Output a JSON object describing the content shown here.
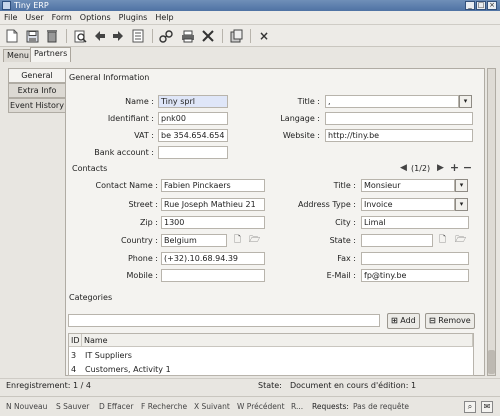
{
  "window": {
    "title": "Tiny ERP"
  },
  "menu": [
    "File",
    "User",
    "Form",
    "Options",
    "Plugins",
    "Help"
  ],
  "toolbar": {
    "icons": [
      "new-icon",
      "save-icon",
      "delete-icon",
      "find-icon",
      "previous-icon",
      "next-icon",
      "switch-view-icon",
      "attach-icon",
      "print-icon",
      "action-icon",
      "plugin-icon",
      "close-icon"
    ]
  },
  "tabs": [
    "Menu",
    "Partners"
  ],
  "vtabs": [
    "General",
    "Extra Info",
    "Event History"
  ],
  "general": {
    "heading": "General Information",
    "name_label": "Name :",
    "name_value": "Tiny sprl",
    "title_label": "Title :",
    "title_value": ",",
    "ident_label": "Identifiant :",
    "ident_value": "pnk00",
    "lang_label": "Langage :",
    "lang_value": "",
    "vat_label": "VAT :",
    "vat_value": "be 354.654.654",
    "website_label": "Website :",
    "website_value": "http://tiny.be",
    "bank_label": "Bank account :",
    "bank_value": ""
  },
  "contacts": {
    "heading": "Contacts",
    "pager": "(1/2)",
    "contact_label": "Contact Name :",
    "contact_value": "Fabien Pinckaers",
    "ctitle_label": "Title :",
    "ctitle_value": "Monsieur",
    "street_label": "Street :",
    "street_value": "Rue Joseph Mathieu 21",
    "addrtype_label": "Address Type :",
    "addrtype_value": "Invoice",
    "zip_label": "Zip :",
    "zip_value": "1300",
    "city_label": "City :",
    "city_value": "Limal",
    "country_label": "Country :",
    "country_value": "Belgium",
    "state_label": "State :",
    "state_value": "",
    "phone_label": "Phone :",
    "phone_value": "(+32).10.68.94.39",
    "fax_label": "Fax :",
    "fax_value": "",
    "mobile_label": "Mobile :",
    "mobile_value": "",
    "email_label": "E-Mail :",
    "email_value": "fp@tiny.be"
  },
  "categories": {
    "heading": "Categories",
    "add_label": "Add",
    "remove_label": "Remove",
    "columns": [
      "ID",
      "Name"
    ],
    "rows": [
      {
        "id": "3",
        "name": "IT Suppliers"
      },
      {
        "id": "4",
        "name": "Customers, Activity 1"
      }
    ]
  },
  "status": {
    "record": "Enregistrement: 1 / 4",
    "state_label": "State:",
    "state_value": "Document en cours d'édition: 1"
  },
  "shortcuts": [
    "N Nouveau",
    "S Sauver",
    "D Effacer",
    "F Recherche",
    "X Suivant",
    "W Précédent",
    "R..."
  ],
  "requests": {
    "label": "Requests:",
    "value": "Pas de requête"
  }
}
